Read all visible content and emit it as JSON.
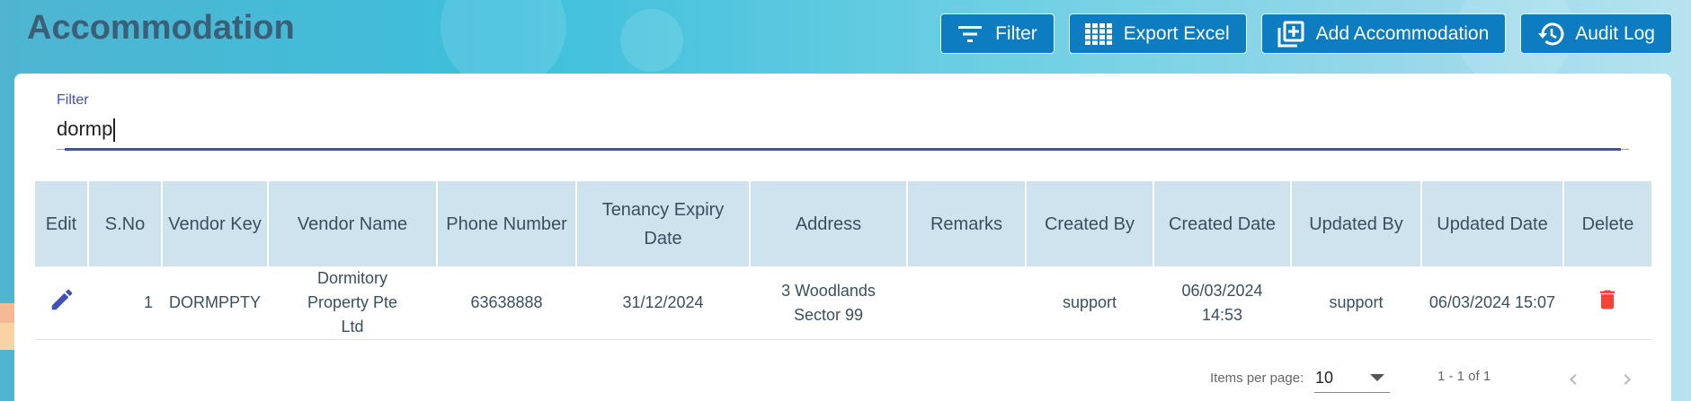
{
  "page": {
    "title": "Accommodation"
  },
  "toolbar": {
    "buttons": [
      {
        "label": "Filter",
        "icon": "filter-icon"
      },
      {
        "label": "Export Excel",
        "icon": "grid-icon"
      },
      {
        "label": "Add Accommodation",
        "icon": "add-box-icon"
      },
      {
        "label": "Audit Log",
        "icon": "history-icon"
      }
    ]
  },
  "filter": {
    "label": "Filter",
    "value": "dormp"
  },
  "table": {
    "headers": [
      "Edit",
      "S.No",
      "Vendor Key",
      "Vendor Name",
      "Phone Number",
      "Tenancy Expiry Date",
      "Address",
      "Remarks",
      "Created By",
      "Created Date",
      "Updated By",
      "Updated Date",
      "Delete"
    ],
    "rows": [
      {
        "sno": "1",
        "vendor_key": "DORMPPTY",
        "vendor_name": "Dormitory Property Pte Ltd",
        "phone": "63638888",
        "tenancy_expiry": "31/12/2024",
        "address": "3 Woodlands Sector 99",
        "remarks": "",
        "created_by": "support",
        "created_date": "06/03/2024 14:53",
        "updated_by": "support",
        "updated_date": "06/03/2024 15:07"
      }
    ]
  },
  "paginator": {
    "items_per_page_label": "Items per page:",
    "page_size": "10",
    "range_label": "1 - 1 of 1"
  },
  "colors": {
    "button_bg": "#0d7cc0",
    "header_bg": "#cfe3ee",
    "accent": "#3f51b5",
    "delete": "#f44336"
  }
}
